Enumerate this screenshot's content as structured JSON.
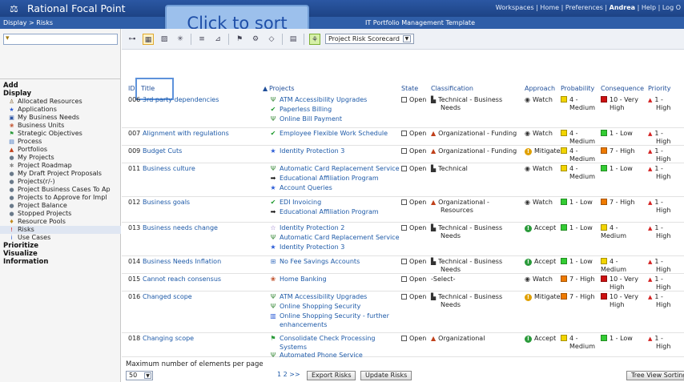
{
  "app": {
    "title": "Rational Focal Point"
  },
  "topnav": {
    "prefix": "Workspaces | Home | Preferences | ",
    "user": "Andrea",
    "suffix": " | Help | Log O"
  },
  "breadcrumb": "Display > Risks",
  "template_name": "IT Portfolio Management Template",
  "tooltip": "Click to sort",
  "sidebar": {
    "groups": [
      "Add",
      "Display",
      "Prioritize",
      "Visualize",
      "Information"
    ],
    "display_items": [
      {
        "label": "Allocated Resources",
        "icon": "person-icon"
      },
      {
        "label": "Applications",
        "icon": "star-icon"
      },
      {
        "label": "My Business Needs",
        "icon": "needs-icon"
      },
      {
        "label": "Business Units",
        "icon": "units-icon"
      },
      {
        "label": "Strategic Objectives",
        "icon": "objectives-icon"
      },
      {
        "label": "Process",
        "icon": "process-icon"
      },
      {
        "label": "Portfolios",
        "icon": "portfolio-icon"
      },
      {
        "label": "My Projects",
        "icon": "globe-icon"
      },
      {
        "label": "Project Roadmap",
        "icon": "roadmap-icon"
      },
      {
        "label": "My Draft Project Proposals",
        "icon": "globe-icon"
      },
      {
        "label": "Projects(r/-)",
        "icon": "globe-icon"
      },
      {
        "label": "Project Business Cases To Ap",
        "icon": "globe-icon"
      },
      {
        "label": "Projects to Approve for Impl",
        "icon": "globe-icon"
      },
      {
        "label": "Project Balance",
        "icon": "globe-icon"
      },
      {
        "label": "Stopped Projects",
        "icon": "globe-icon"
      },
      {
        "label": "Resource Pools",
        "icon": "pool-icon"
      },
      {
        "label": "Risks",
        "icon": "risk-icon"
      },
      {
        "label": "Use Cases",
        "icon": "info-icon"
      }
    ]
  },
  "toolbar": {
    "view_select": "Project Risk Scorecard"
  },
  "columns": {
    "id": "ID",
    "title": "Title",
    "projects": "Projects",
    "state": "State",
    "classification": "Classification",
    "approach": "Approach",
    "probability": "Probability",
    "consequence": "Consequence",
    "priority": "Priority"
  },
  "rows": [
    {
      "id": "006",
      "title": "3rd party dependencies",
      "projects": [
        {
          "name": "ATM Accessibility Upgrades",
          "icon": "fork-icon"
        },
        {
          "name": "Paperless Billing",
          "icon": "check-circle-icon"
        },
        {
          "name": "Online Bill Payment",
          "icon": "fork-icon"
        }
      ],
      "state": "Open",
      "classification": [
        "Technical - Business",
        "Needs"
      ],
      "class_icon": "computer-icon",
      "approach": "Watch",
      "approach_icon": "eye-icon",
      "probability": [
        "4 -",
        "Medium"
      ],
      "prob_color": "#f2d400",
      "consequence": [
        "10 - Very",
        "High"
      ],
      "cons_color": "#cc1111",
      "priority": [
        "1 -",
        "High"
      ]
    },
    {
      "id": "007",
      "title": "Alignment with regulations",
      "projects": [
        {
          "name": "Employee Flexible Work Schedule",
          "icon": "check-circle-icon"
        }
      ],
      "state": "Open",
      "classification": [
        "Organizational - Funding"
      ],
      "class_icon": "org-icon",
      "approach": "Watch",
      "approach_icon": "eye-icon",
      "probability": [
        "4 -",
        "Medium"
      ],
      "prob_color": "#f2d400",
      "consequence": [
        "1 - Low"
      ],
      "cons_color": "#33cc33",
      "priority": [
        "1 -",
        "High"
      ]
    },
    {
      "id": "009",
      "title": "Budget Cuts",
      "projects": [
        {
          "name": "Identity Protection 3",
          "icon": "star-icon"
        }
      ],
      "state": "Open",
      "classification": [
        "Organizational - Funding"
      ],
      "class_icon": "org-icon",
      "approach": "Mitigate",
      "approach_icon": "warning-icon",
      "probability": [
        "4 -",
        "Medium"
      ],
      "prob_color": "#f2d400",
      "consequence": [
        "7 - High"
      ],
      "cons_color": "#ee7a00",
      "priority": [
        "1 -",
        "High"
      ]
    },
    {
      "id": "011",
      "title": "Business culture",
      "projects": [
        {
          "name": "Automatic Card Replacement Service",
          "icon": "fork-icon"
        },
        {
          "name": "Educational Affiliation Program",
          "icon": "arrow-icon"
        },
        {
          "name": "Account Queries",
          "icon": "star-icon"
        }
      ],
      "state": "Open",
      "classification": [
        "Technical"
      ],
      "class_icon": "computer-icon",
      "approach": "Watch",
      "approach_icon": "eye-icon",
      "probability": [
        "4 -",
        "Medium"
      ],
      "prob_color": "#f2d400",
      "consequence": [
        "1 - Low"
      ],
      "cons_color": "#33cc33",
      "priority": [
        "1 -",
        "High"
      ]
    },
    {
      "id": "012",
      "title": "Business goals",
      "projects": [
        {
          "name": "EDI Invoicing",
          "icon": "check-circle-icon"
        },
        {
          "name": "Educational Affiliation Program",
          "icon": "arrow-icon"
        }
      ],
      "state": "Open",
      "classification": [
        "Organizational -",
        "Resources"
      ],
      "class_icon": "org-icon",
      "approach": "Watch",
      "approach_icon": "eye-icon",
      "probability": [
        "1 - Low"
      ],
      "prob_color": "#33cc33",
      "consequence": [
        "7 - High"
      ],
      "cons_color": "#ee7a00",
      "priority": [
        "1 -",
        "High"
      ]
    },
    {
      "id": "013",
      "title": "Business needs change",
      "projects": [
        {
          "name": "Identity Protection 2",
          "icon": "star-outline-icon"
        },
        {
          "name": "Automatic Card Replacement Service",
          "icon": "fork-icon"
        },
        {
          "name": "Identity Protection 3",
          "icon": "star-icon"
        }
      ],
      "state": "Open",
      "classification": [
        "Technical - Business",
        "Needs"
      ],
      "class_icon": "computer-icon",
      "approach": "Accept",
      "approach_icon": "accept-icon",
      "probability": [
        "1 - Low"
      ],
      "prob_color": "#33cc33",
      "consequence": [
        "4 - Medium"
      ],
      "cons_color": "#f2d400",
      "priority": [
        "1 -",
        "High"
      ]
    },
    {
      "id": "014",
      "title": "Business Needs Inflation",
      "projects": [
        {
          "name": "No Fee Savings Accounts",
          "icon": "savings-icon"
        }
      ],
      "state": "Open",
      "classification": [
        "Technical - Business",
        "Needs"
      ],
      "class_icon": "computer-icon",
      "approach": "Accept",
      "approach_icon": "accept-icon",
      "probability": [
        "1 - Low"
      ],
      "prob_color": "#33cc33",
      "consequence": [
        "4 - Medium"
      ],
      "cons_color": "#f2d400",
      "priority": [
        "1 -",
        "High"
      ]
    },
    {
      "id": "015",
      "title": "Cannot reach consensus",
      "projects": [
        {
          "name": "Home Banking",
          "icon": "units-icon"
        }
      ],
      "state": "Open",
      "classification": [
        "-Select-"
      ],
      "class_icon": "",
      "approach": "Watch",
      "approach_icon": "eye-icon",
      "probability": [
        "7 - High"
      ],
      "prob_color": "#ee7a00",
      "consequence": [
        "10 - Very",
        "High"
      ],
      "cons_color": "#cc1111",
      "priority": [
        "1 -",
        "High"
      ]
    },
    {
      "id": "016",
      "title": "Changed scope",
      "projects": [
        {
          "name": "ATM Accessibility Upgrades",
          "icon": "fork-icon"
        },
        {
          "name": "Online Shopping Security",
          "icon": "fork-icon"
        },
        {
          "name": "Online Shopping Security - further",
          "name2": "enhancements",
          "icon": "doc-icon"
        }
      ],
      "state": "Open",
      "classification": [
        "Technical - Business",
        "Needs"
      ],
      "class_icon": "computer-icon",
      "approach": "Mitigate",
      "approach_icon": "warning-icon",
      "probability": [
        "7 - High"
      ],
      "prob_color": "#ee7a00",
      "consequence": [
        "10 - Very",
        "High"
      ],
      "cons_color": "#cc1111",
      "priority": [
        "1 -",
        "High"
      ]
    },
    {
      "id": "018",
      "title": "Changing scope",
      "projects": [
        {
          "name": "Consolidate Check Processing",
          "name2": "Systems",
          "icon": "objectives-icon"
        },
        {
          "name": "Automated Phone Service",
          "icon": "fork-icon"
        }
      ],
      "state": "Open",
      "classification": [
        "Organizational"
      ],
      "class_icon": "org-icon",
      "approach": "Accept",
      "approach_icon": "accept-icon",
      "probability": [
        "4 -",
        "Medium"
      ],
      "prob_color": "#f2d400",
      "consequence": [
        "1 - Low"
      ],
      "cons_color": "#33cc33",
      "priority": [
        "1 -",
        "High"
      ]
    }
  ],
  "footer": {
    "max_label": "Maximum number of elements per page",
    "per_page": "50",
    "pager": "1 2 >>",
    "export_label": "Export Risks",
    "update_label": "Update Risks",
    "tree_label": "Tree View Sorting"
  },
  "colors": {
    "accent": "#1f4fa8",
    "link": "#1e5aa8",
    "priority_arrow": "#d42020"
  }
}
